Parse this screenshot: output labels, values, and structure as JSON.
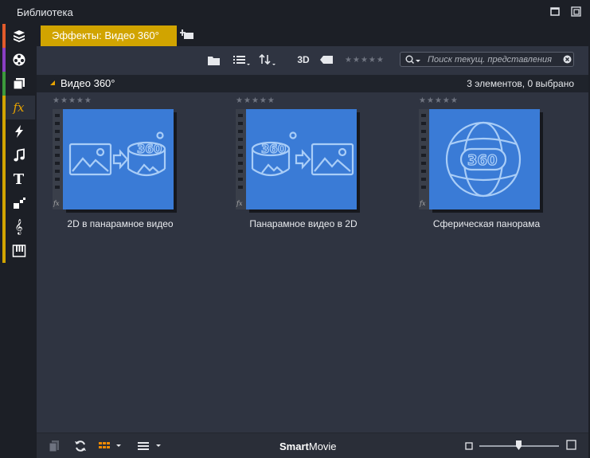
{
  "window": {
    "title": "Библиотека"
  },
  "sidebar": {
    "items": [
      {
        "icon": "cube-stack-icon",
        "color": "#e25b2b"
      },
      {
        "icon": "film-reel-icon",
        "color": "#8a3ec2"
      },
      {
        "icon": "clip-stack-icon",
        "color": "#3c9a3c"
      },
      {
        "icon": "fx-icon",
        "color": "#d1a400",
        "active": true
      },
      {
        "icon": "transition-bolt-icon",
        "color": "#d1a400"
      },
      {
        "icon": "music-note-icon",
        "color": "#d1a400"
      },
      {
        "icon": "title-t-icon",
        "color": "#d1a400"
      },
      {
        "icon": "montage-icon",
        "color": "#d1a400"
      },
      {
        "icon": "treble-clef-icon",
        "color": "#d1a400"
      },
      {
        "icon": "piano-keys-icon",
        "color": "#d1a400"
      }
    ]
  },
  "tabs": {
    "active_label": "Эффекты: Видео 360°"
  },
  "toolbar": {
    "view_3d": "3D",
    "search_placeholder": "Поиск текущ. представления",
    "rating": 0
  },
  "section": {
    "title": "Видео 360°",
    "count": "3 элементов, 0 выбрано"
  },
  "items": [
    {
      "label": "2D в панарамное видео",
      "rating": 0
    },
    {
      "label": "Панарамное видео в 2D",
      "rating": 0
    },
    {
      "label": "Сферическая панорама",
      "rating": 0
    }
  ],
  "bottombar": {
    "brand_bold": "Smart",
    "brand_rest": "Movie",
    "zoom": 0.47
  },
  "colors": {
    "accent": "#d1a400",
    "thumb_bg": "#3a7bd6",
    "panel": "#2f3441"
  }
}
